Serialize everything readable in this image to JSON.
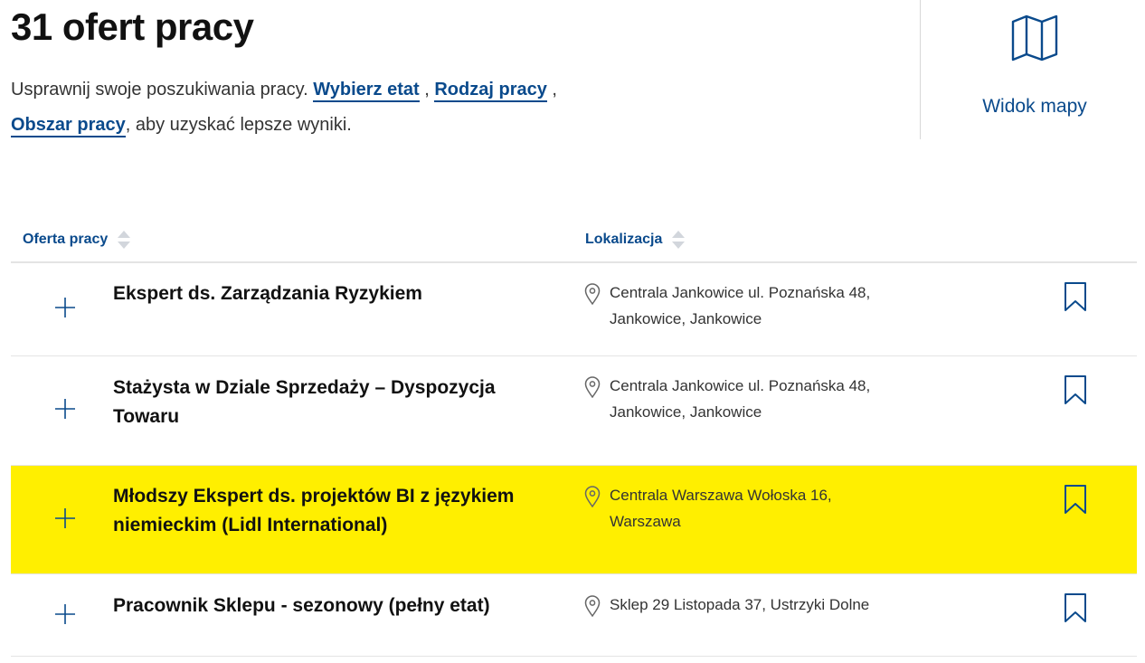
{
  "header": {
    "title": "31 ofert pracy",
    "intro_prefix": "Usprawnij swoje poszukiwania pracy.",
    "link_etat": "Wybierz etat",
    "sep1": " ,",
    "link_rodzaj": "Rodzaj pracy",
    "sep2": " ,",
    "link_obszar": "Obszar pracy",
    "intro_suffix": ", aby uzyskać lepsze wyniki."
  },
  "map_view": {
    "label": "Widok mapy",
    "icon": "map-icon"
  },
  "table": {
    "columns": {
      "offer": "Oferta pracy",
      "location": "Lokalizacja"
    },
    "rows": [
      {
        "title": "Ekspert ds. Zarządzania Ryzykiem",
        "location": "Centrala Jankowice ul. Poznańska 48, Jankowice, Jankowice",
        "highlighted": false
      },
      {
        "title": "Stażysta w Dziale Sprzedaży – Dyspozycja Towaru",
        "location": "Centrala Jankowice ul. Poznańska 48, Jankowice, Jankowice",
        "highlighted": false
      },
      {
        "title": "Młodszy Ekspert ds. projektów BI z językiem niemieckim (Lidl International)",
        "location": "Centrala Warszawa Wołoska 16, Warszawa",
        "highlighted": true
      },
      {
        "title": "Pracownik Sklepu - sezonowy (pełny etat)",
        "location": "Sklep 29 Listopada 37, Ustrzyki Dolne",
        "highlighted": false
      }
    ]
  },
  "colors": {
    "accent": "#0a4a8c",
    "highlight": "#ffef00",
    "divider": "#e4e4e4"
  }
}
